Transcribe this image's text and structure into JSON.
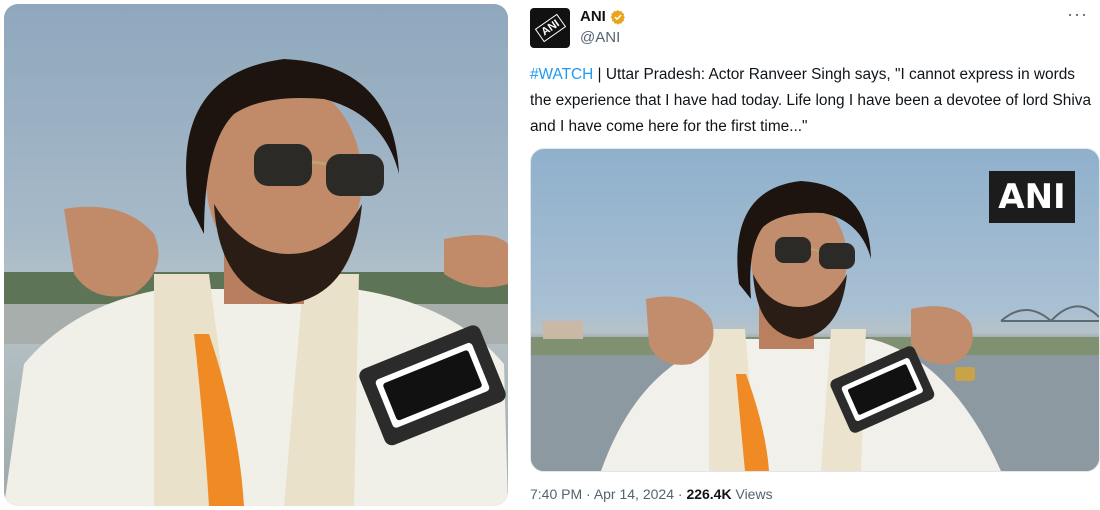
{
  "post": {
    "author_name": "ANI",
    "author_handle": "@ANI",
    "avatar_text": "ANI",
    "more_label": "···",
    "hashtag": "#WATCH",
    "separator": " | ",
    "text": "Uttar Pradesh: Actor Ranveer Singh says, \"I cannot express in words the experience that I have had today. Life long I have been a devotee of lord Shiva and I have come here for the first time...\"",
    "media_watermark": "ANI",
    "time": "7:40 PM",
    "dot": " · ",
    "date": "Apr 14, 2024",
    "views_count": "226.4K",
    "views_label": " Views"
  },
  "colors": {
    "link": "#1d9bf0",
    "text": "#0f1419",
    "secondary": "#536471",
    "verified": "#e8a41a"
  },
  "icons": {
    "verified": "verified-badge-icon",
    "more": "more-horizontal-icon"
  }
}
